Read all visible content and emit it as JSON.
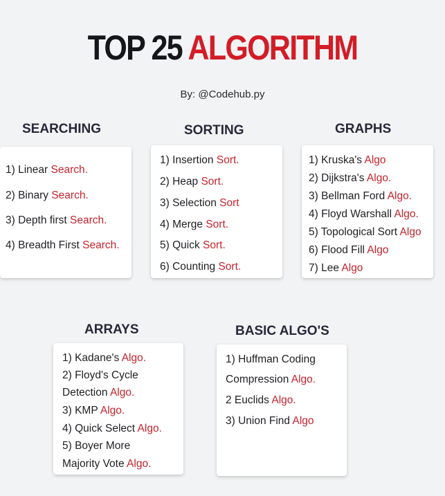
{
  "title": {
    "part1": "TOP 25",
    "part2": "ALGORITHM"
  },
  "byline": "By: @Codehub.py",
  "colors": {
    "accent": "#d21d27",
    "text": "#1f1f23",
    "background": "#f2f3f4"
  },
  "sections": {
    "searching": {
      "heading": "SEARCHING",
      "items": [
        {
          "text": "1) Linear ",
          "accent": "Search."
        },
        {
          "text": "2) Binary ",
          "accent": "Search."
        },
        {
          "text": "3) Depth first ",
          "accent": "Search."
        },
        {
          "text": "4) Breadth First ",
          "accent": "Search."
        }
      ]
    },
    "sorting": {
      "heading": "SORTING",
      "items": [
        {
          "text": "1) Insertion ",
          "accent": "Sort."
        },
        {
          "text": "2) Heap ",
          "accent": "Sort."
        },
        {
          "text": "3) Selection ",
          "accent": "Sort"
        },
        {
          "text": "4) Merge ",
          "accent": "Sort."
        },
        {
          "text": "5) Quick ",
          "accent": "Sort."
        },
        {
          "text": "6) Counting ",
          "accent": "Sort."
        }
      ]
    },
    "graphs": {
      "heading": "GRAPHS",
      "items": [
        {
          "text": "1) Kruska's ",
          "accent": "Algo"
        },
        {
          "text": "2) Dijkstra's ",
          "accent": "Algo."
        },
        {
          "text": "3) Bellman Ford ",
          "accent": "Algo."
        },
        {
          "text": "4) Floyd Warshall ",
          "accent": "Algo."
        },
        {
          "text": "5) Topological Sort ",
          "accent": "Algo"
        },
        {
          "text": "6) Flood Fill ",
          "accent": "Algo"
        },
        {
          "text": "7) Lee ",
          "accent": "Algo"
        }
      ]
    },
    "arrays": {
      "heading": "ARRAYS",
      "items": [
        {
          "text": "1) Kadane's ",
          "accent": "Algo."
        },
        {
          "text": "2) Floyd's Cycle",
          "accent": ""
        },
        {
          "text": "Detection ",
          "accent": "Algo."
        },
        {
          "text": "3) KMP ",
          "accent": "Algo."
        },
        {
          "text": "4) Quick Select ",
          "accent": "Algo."
        },
        {
          "text": "5) Boyer More",
          "accent": ""
        },
        {
          "text": "Majority Vote ",
          "accent": "Algo."
        }
      ]
    },
    "basic": {
      "heading": "BASIC ALGO'S",
      "items": [
        {
          "text": "1) Huffman Coding",
          "accent": ""
        },
        {
          "text": "Compression ",
          "accent": "Algo."
        },
        {
          "text": "2 Euclids ",
          "accent": "Algo."
        },
        {
          "text": "3) Union Find ",
          "accent": "Algo"
        }
      ]
    }
  }
}
